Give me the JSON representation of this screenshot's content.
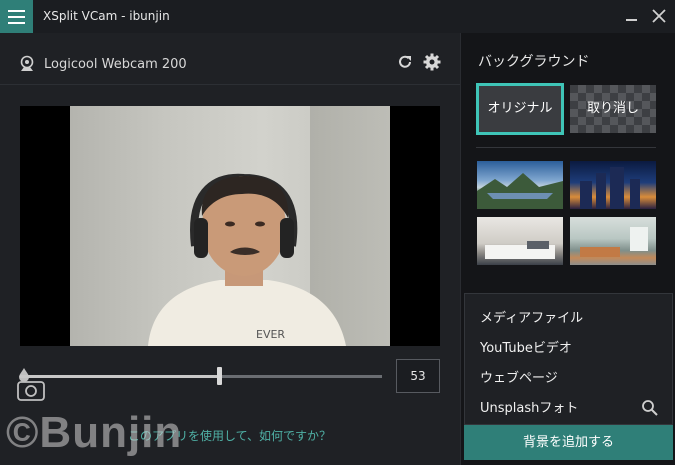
{
  "window": {
    "title": "XSplit VCam - ibunjin"
  },
  "camera": {
    "name": "Logicool Webcam 200"
  },
  "blur": {
    "value": "53",
    "level_fraction": 0.55
  },
  "feedback": {
    "text": "このアプリを使用して、如何ですか？"
  },
  "watermark": {
    "text": "©Bunjin"
  },
  "background": {
    "title": "バックグラウンド",
    "original_label": "オリジナル",
    "cancel_label": "取り消し",
    "thumbnails": [
      "mountain-lake-thumbnail",
      "city-skyline-thumbnail",
      "bedroom-thumbnail",
      "living-room-thumbnail"
    ]
  },
  "menu": {
    "items": [
      "メディアファイル",
      "YouTubeビデオ",
      "ウェブページ",
      "Unsplashフォト"
    ]
  },
  "add_button": {
    "label": "背景を追加する"
  },
  "colors": {
    "accent": "#2f7f78",
    "selected_border": "#3fc5b8",
    "link": "#4fb0a5"
  }
}
